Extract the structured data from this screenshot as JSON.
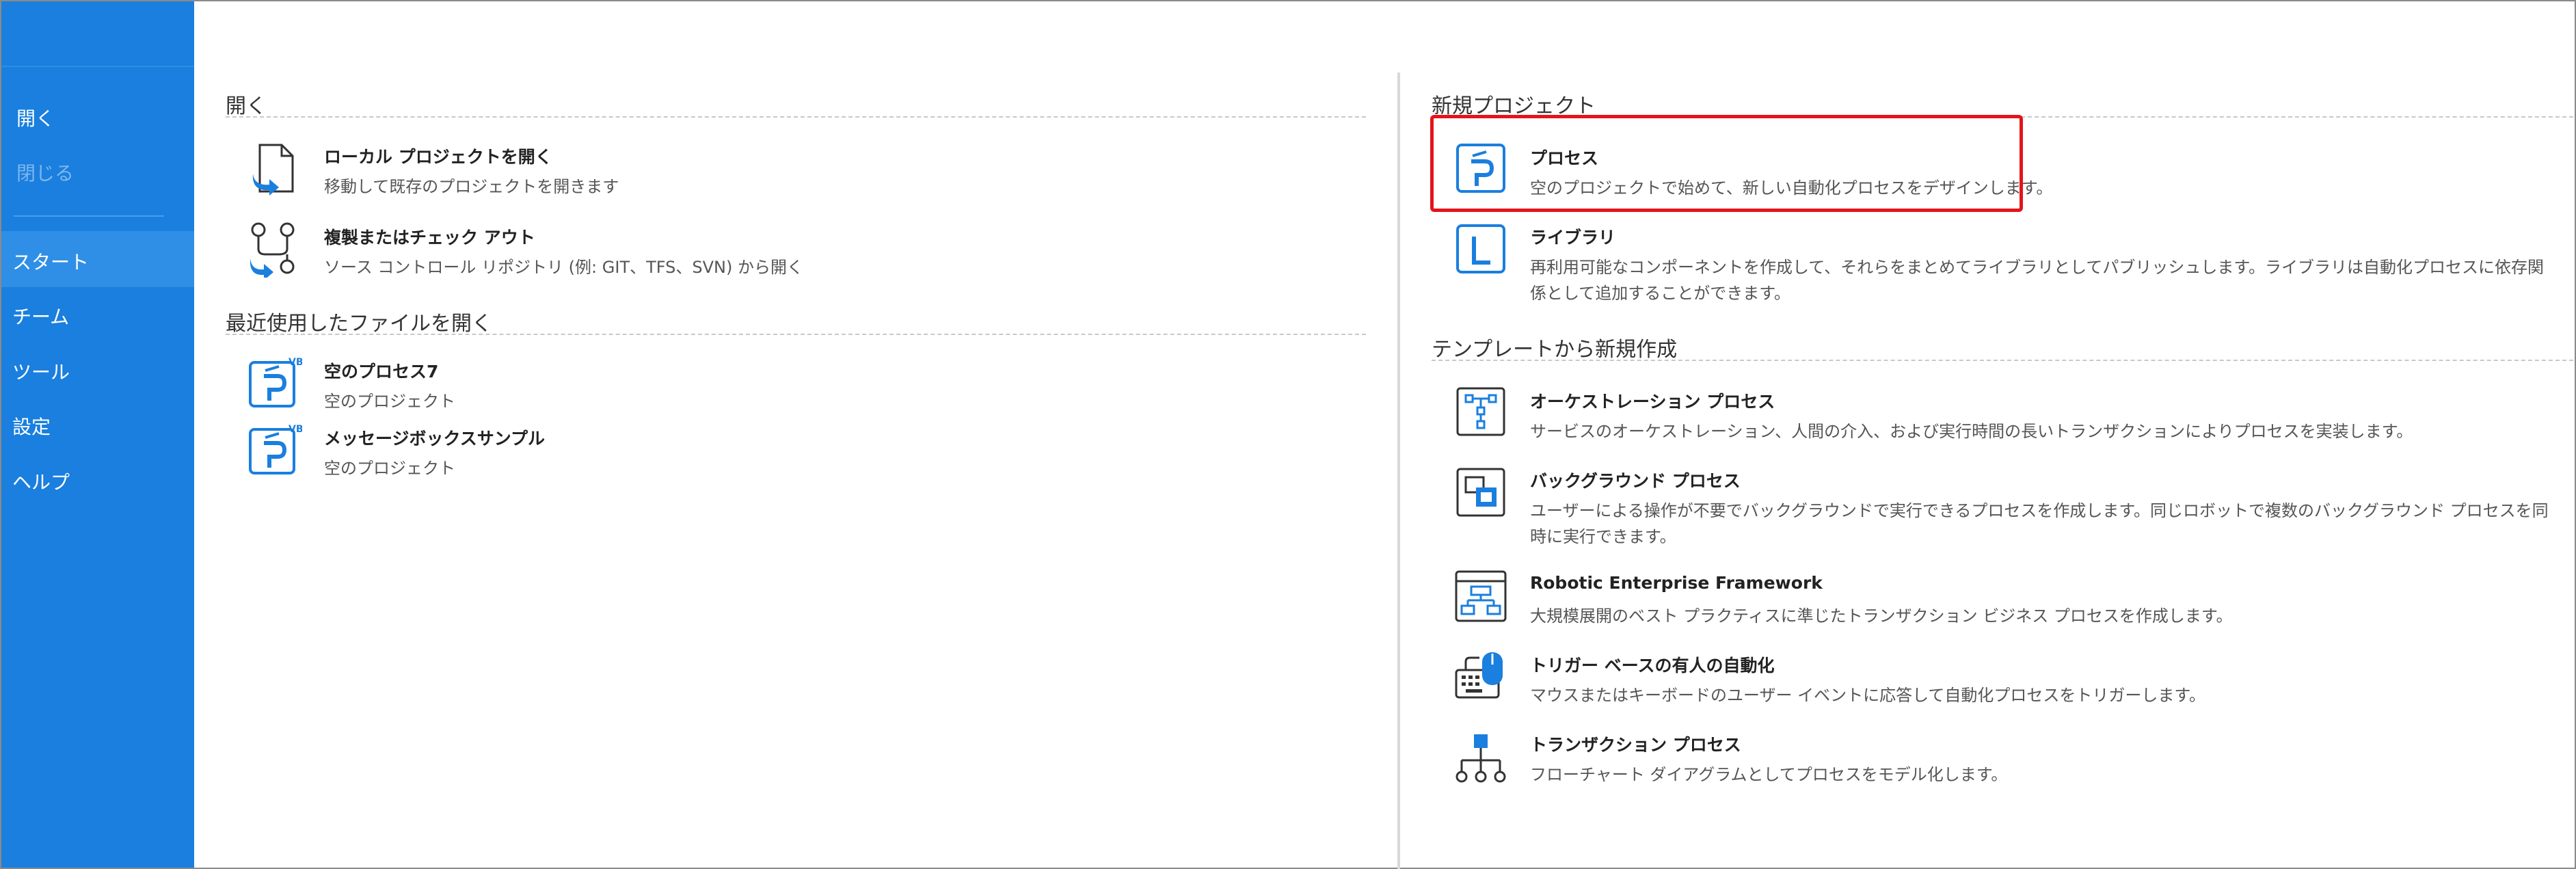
{
  "sidebar": {
    "items": [
      {
        "label": "開く",
        "disabled": false
      },
      {
        "label": "閉じる",
        "disabled": true
      },
      {
        "label": "スタート",
        "active": true
      },
      {
        "label": "チーム"
      },
      {
        "label": "ツール"
      },
      {
        "label": "設定"
      },
      {
        "label": "ヘルプ"
      }
    ]
  },
  "open_section": {
    "title": "開く",
    "items": [
      {
        "title": "ローカル プロジェクトを開く",
        "desc": "移動して既存のプロジェクトを開きます",
        "icon": "open-file-icon"
      },
      {
        "title": "複製またはチェック アウト",
        "desc": "ソース コントロール リポジトリ (例: GIT、TFS、SVN) から開く",
        "icon": "branch-icon"
      }
    ]
  },
  "recent_section": {
    "title": "最近使用したファイルを開く",
    "items": [
      {
        "title": "空のプロセス7",
        "desc": "空のプロジェクト",
        "icon": "process-vb-icon",
        "badge": "VB"
      },
      {
        "title": "メッセージボックスサンプル",
        "desc": "空のプロジェクト",
        "icon": "process-vb-icon",
        "badge": "VB"
      }
    ]
  },
  "new_project": {
    "title": "新規プロジェクト",
    "items": [
      {
        "title": "プロセス",
        "desc": "空のプロジェクトで始めて、新しい自動化プロセスをデザインします。",
        "icon": "process-icon",
        "highlighted": true
      },
      {
        "title": "ライブラリ",
        "desc": "再利用可能なコンポーネントを作成して、それらをまとめてライブラリとしてパブリッシュします。ライブラリは自動化プロセスに依存関係として追加することができます。",
        "icon": "library-icon"
      }
    ]
  },
  "templates": {
    "title": "テンプレートから新規作成",
    "items": [
      {
        "title": "オーケストレーション プロセス",
        "desc": "サービスのオーケストレーション、人間の介入、および実行時間の長いトランザクションによりプロセスを実装します。",
        "icon": "orchestration-icon"
      },
      {
        "title": "バックグラウンド プロセス",
        "desc": "ユーザーによる操作が不要でバックグラウンドで実行できるプロセスを作成します。同じロボットで複数のバックグラウンド プロセスを同時に実行できます。",
        "icon": "background-process-icon"
      },
      {
        "title": "Robotic Enterprise Framework",
        "desc": "大規模展開のベスト プラクティスに準じたトランザクション ビジネス プロセスを作成します。",
        "icon": "framework-icon"
      },
      {
        "title": "トリガー ベースの有人の自動化",
        "desc": "マウスまたはキーボードのユーザー イベントに応答して自動化プロセスをトリガーします。",
        "icon": "trigger-icon"
      },
      {
        "title": "トランザクション プロセス",
        "desc": "フローチャート ダイアグラムとしてプロセスをモデル化します。",
        "icon": "transaction-icon"
      }
    ]
  },
  "colors": {
    "sidebar": "#1a7fde",
    "accent": "#1a7fde",
    "highlight": "#e3141a"
  }
}
